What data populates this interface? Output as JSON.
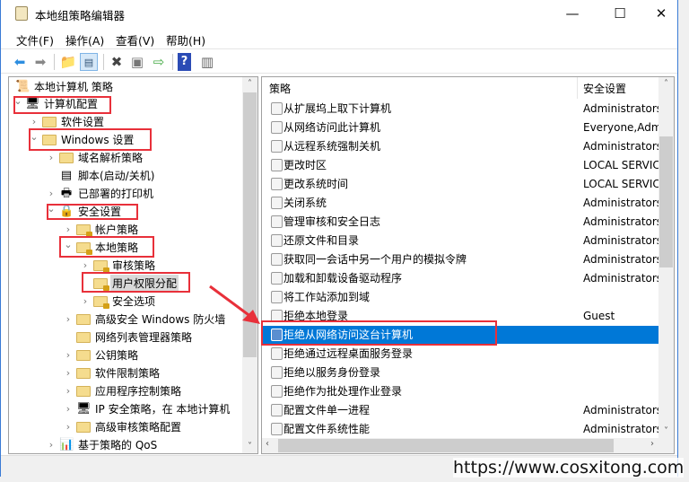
{
  "window": {
    "title": "本地组策略编辑器",
    "minimize": "—",
    "maximize": "☐",
    "close": "✕"
  },
  "menu": [
    "文件(F)",
    "操作(A)",
    "查看(V)",
    "帮助(H)"
  ],
  "toolbar": [
    "back-icon",
    "forward-icon",
    "up-folder-icon",
    "show-hide-tree-icon",
    "delete-icon",
    "properties-icon",
    "export-list-icon",
    "help-icon",
    "show-action-pane-icon"
  ],
  "tree": [
    {
      "label": "本地计算机 策略",
      "level": 0,
      "chevron": "",
      "icon": "policy"
    },
    {
      "label": "计算机配置",
      "level": 1,
      "chevron": "v",
      "icon": "computer"
    },
    {
      "label": "软件设置",
      "level": 2,
      "chevron": ">",
      "icon": "folder"
    },
    {
      "label": "Windows 设置",
      "level": 2,
      "chevron": "v",
      "icon": "folder"
    },
    {
      "label": "域名解析策略",
      "level": 3,
      "chevron": ">",
      "icon": "folder"
    },
    {
      "label": "脚本(启动/关机)",
      "level": 3,
      "chevron": "",
      "icon": "script"
    },
    {
      "label": "已部署的打印机",
      "level": 3,
      "chevron": ">",
      "icon": "printer"
    },
    {
      "label": "安全设置",
      "level": 3,
      "chevron": "v",
      "icon": "security"
    },
    {
      "label": "帐户策略",
      "level": 4,
      "chevron": ">",
      "icon": "lockfolder"
    },
    {
      "label": "本地策略",
      "level": 4,
      "chevron": "v",
      "icon": "lockfolder"
    },
    {
      "label": "审核策略",
      "level": 5,
      "chevron": ">",
      "icon": "lockfolder"
    },
    {
      "label": "用户权限分配",
      "level": 5,
      "chevron": "",
      "icon": "lockfolder",
      "selected": true
    },
    {
      "label": "安全选项",
      "level": 5,
      "chevron": ">",
      "icon": "lockfolder"
    },
    {
      "label": "高级安全 Windows 防火墙",
      "level": 4,
      "chevron": ">",
      "icon": "folder"
    },
    {
      "label": "网络列表管理器策略",
      "level": 4,
      "chevron": "",
      "icon": "folder"
    },
    {
      "label": "公钥策略",
      "level": 4,
      "chevron": ">",
      "icon": "folder"
    },
    {
      "label": "软件限制策略",
      "level": 4,
      "chevron": ">",
      "icon": "folder"
    },
    {
      "label": "应用程序控制策略",
      "level": 4,
      "chevron": ">",
      "icon": "folder"
    },
    {
      "label": "IP 安全策略，在 本地计算机",
      "level": 4,
      "chevron": ">",
      "icon": "ipsec"
    },
    {
      "label": "高级审核策略配置",
      "level": 4,
      "chevron": ">",
      "icon": "folder"
    },
    {
      "label": "基于策略的 QoS",
      "level": 3,
      "chevron": ">",
      "icon": "chart"
    }
  ],
  "list": {
    "columns": [
      "策略",
      "安全设置"
    ],
    "rows": [
      {
        "policy": "从扩展坞上取下计算机",
        "setting": "Administrators,U"
      },
      {
        "policy": "从网络访问此计算机",
        "setting": "Everyone,Admin"
      },
      {
        "policy": "从远程系统强制关机",
        "setting": "Administrators"
      },
      {
        "policy": "更改时区",
        "setting": "LOCAL SERVICE,"
      },
      {
        "policy": "更改系统时间",
        "setting": "LOCAL SERVICE,"
      },
      {
        "policy": "关闭系统",
        "setting": "Administrators,U"
      },
      {
        "policy": "管理审核和安全日志",
        "setting": "Administrators"
      },
      {
        "policy": "还原文件和目录",
        "setting": "Administrators,E"
      },
      {
        "policy": "获取同一会话中另一个用户的模拟令牌",
        "setting": "Administrators"
      },
      {
        "policy": "加载和卸载设备驱动程序",
        "setting": "Administrators"
      },
      {
        "policy": "将工作站添加到域",
        "setting": ""
      },
      {
        "policy": "拒绝本地登录",
        "setting": "Guest"
      },
      {
        "policy": "拒绝从网络访问这台计算机",
        "setting": "",
        "selected": true
      },
      {
        "policy": "拒绝通过远程桌面服务登录",
        "setting": ""
      },
      {
        "policy": "拒绝以服务身份登录",
        "setting": ""
      },
      {
        "policy": "拒绝作为批处理作业登录",
        "setting": ""
      },
      {
        "policy": "配置文件单一进程",
        "setting": "Administrators"
      },
      {
        "policy": "配置文件系统性能",
        "setting": "Administrators,N"
      }
    ]
  },
  "colors": {
    "selection": "#0078d7",
    "annotation": "#e8303a",
    "folder": "#f5dc8e"
  },
  "watermark": "https://www.cosxitong.com"
}
